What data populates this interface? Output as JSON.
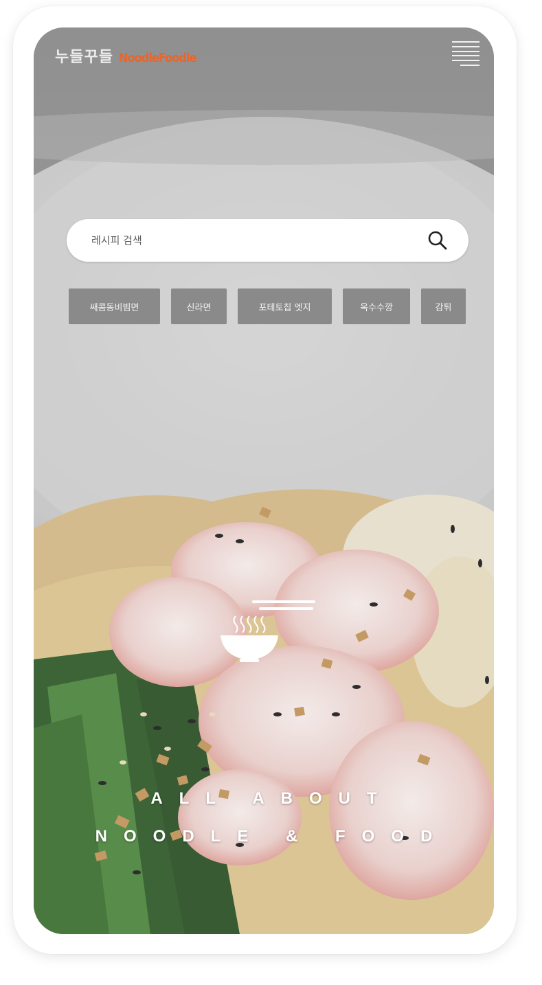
{
  "header": {
    "logo_korean": "누들꾸들",
    "logo_english": "NoodleFoodle",
    "menu_icon": "hamburger-menu-icon"
  },
  "search": {
    "placeholder": "레시피 검색",
    "icon": "search-icon"
  },
  "tags": [
    "쌔콤동비빔면",
    "신라면",
    "포테토칩 엣지",
    "옥수수깡",
    "감튀"
  ],
  "hero": {
    "icon": "noodle-bowl-icon",
    "tagline_line1": "ALL ABOUT",
    "tagline_line2": "NOODLE & FOOD"
  },
  "colors": {
    "brand_orange": "#e8662c",
    "tag_bg": "#8a8a8a",
    "overlay": "#9e9e9e"
  }
}
